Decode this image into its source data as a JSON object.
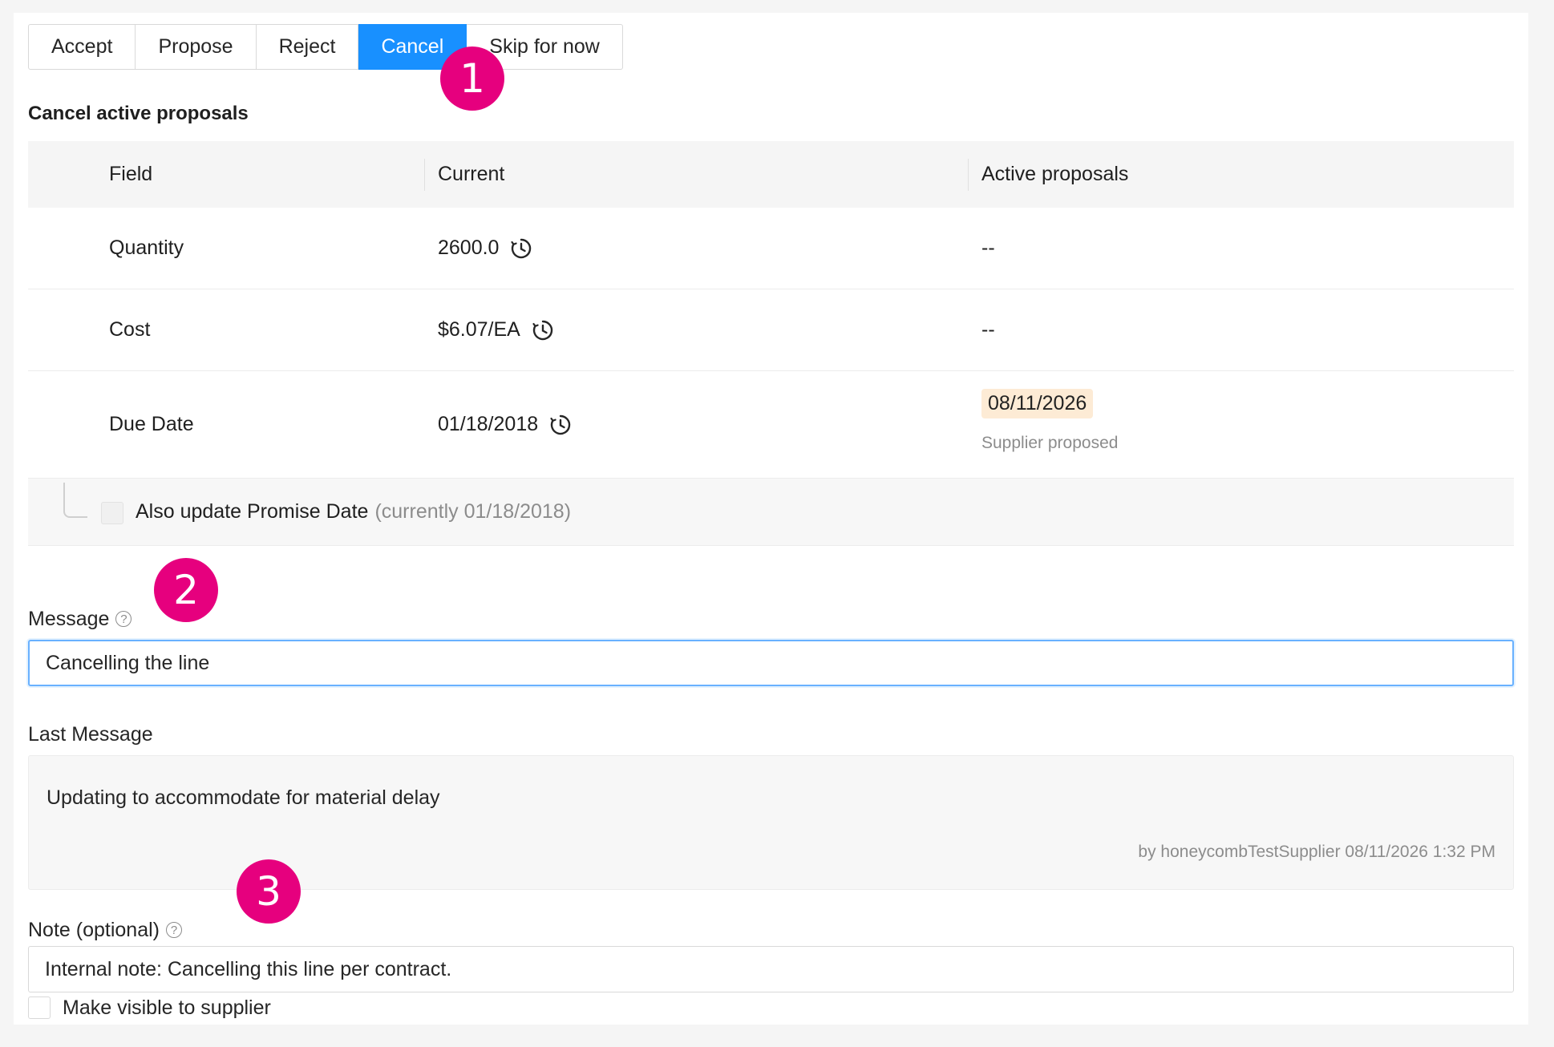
{
  "actions": {
    "buttons": [
      "Accept",
      "Propose",
      "Reject",
      "Cancel",
      "Skip for now"
    ],
    "active": "Cancel"
  },
  "callouts": [
    "1",
    "2",
    "3"
  ],
  "section_title": "Cancel active proposals",
  "table": {
    "headers": [
      "Field",
      "Current",
      "Active proposals"
    ],
    "rows": [
      {
        "field": "Quantity",
        "current": "2600.0",
        "proposal": "--"
      },
      {
        "field": "Cost",
        "current": "$6.07/EA",
        "proposal": "--"
      },
      {
        "field": "Due Date",
        "current": "01/18/2018",
        "proposal": "08/11/2026",
        "proposal_note": "Supplier proposed"
      }
    ],
    "promise": {
      "label": "Also update Promise Date",
      "hint": "(currently 01/18/2018)"
    }
  },
  "message": {
    "label": "Message",
    "value": "Cancelling the line"
  },
  "last_message": {
    "label": "Last Message",
    "text": "Updating to accommodate for material delay",
    "meta": "by honeycombTestSupplier 08/11/2026 1:32 PM"
  },
  "note": {
    "label": "Note (optional)",
    "value": "Internal note: Cancelling this line per contract.",
    "visible_label": "Make visible to supplier"
  },
  "colors": {
    "accent": "#1890ff",
    "callout": "#e6007e",
    "proposal_highlight": "#fdebd5"
  },
  "icons": {
    "history": "clock-history-icon",
    "help": "question-circle-icon"
  }
}
